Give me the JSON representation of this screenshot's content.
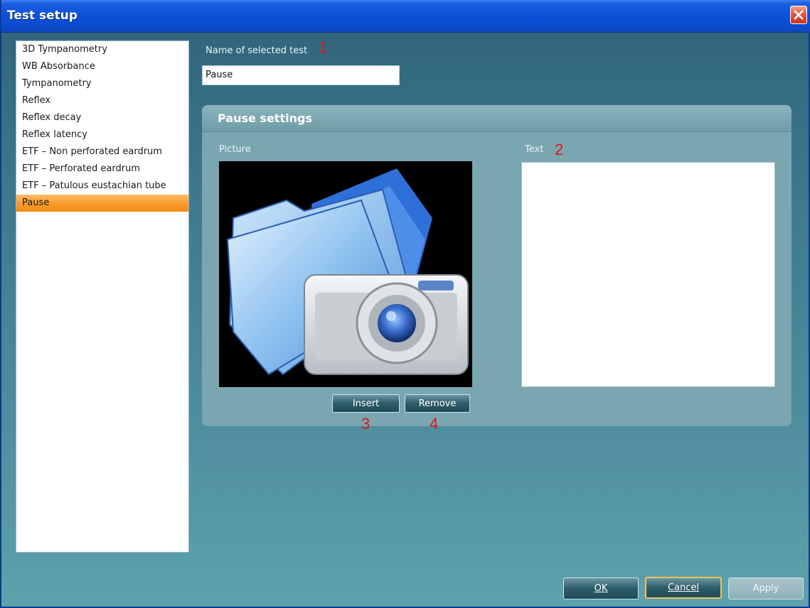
{
  "window": {
    "title": "Test setup"
  },
  "tests": [
    {
      "label": "3D Tympanometry",
      "selected": false
    },
    {
      "label": "WB Absorbance",
      "selected": false
    },
    {
      "label": "Tympanometry",
      "selected": false
    },
    {
      "label": "Reflex",
      "selected": false
    },
    {
      "label": "Reflex decay",
      "selected": false
    },
    {
      "label": "Reflex latency",
      "selected": false
    },
    {
      "label": "ETF – Non perforated eardrum",
      "selected": false
    },
    {
      "label": "ETF – Perforated eardrum",
      "selected": false
    },
    {
      "label": "ETF – Patulous eustachian tube",
      "selected": false
    },
    {
      "label": "Pause",
      "selected": true
    }
  ],
  "name_field": {
    "label": "Name of selected test",
    "value": "Pause"
  },
  "pause_settings": {
    "title": "Pause settings",
    "picture_label": "Picture",
    "text_label": "Text",
    "text_value": "",
    "insert_label": "Insert",
    "remove_label": "Remove"
  },
  "annotations": {
    "a1": "1",
    "a2": "2",
    "a3": "3",
    "a4": "4"
  },
  "footer": {
    "ok_label": "OK",
    "cancel_label": "Cancel",
    "apply_label": "Apply"
  },
  "icons": {
    "close": "close-x-icon",
    "picture": "folder-camera-icon"
  },
  "colors": {
    "selection": "#f99a2a",
    "annotation": "#e01818",
    "titlebar": "#0c50d8"
  }
}
